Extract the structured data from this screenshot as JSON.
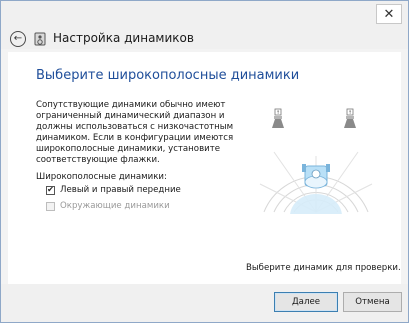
{
  "window": {
    "title": "Настройка динамиков",
    "close_glyph": "✕",
    "back_glyph": "←"
  },
  "page": {
    "heading": "Выберите широкополосные динамики",
    "description": "Сопутствующие динамики обычно имеют ограниченный динамический диапазон и должны использоваться с низкочастотным динамиком.  Если в конфигурации имеются широкополосные динамики, установите соответствующие флажки.",
    "checkbox_section_label": "Широкополосные динамики:",
    "checkboxes": [
      {
        "label": "Левый и правый передние",
        "checked": true,
        "enabled": true
      },
      {
        "label": "Окружающие динамики",
        "checked": false,
        "enabled": false
      }
    ],
    "test_hint": "Выберите динамик для проверки.",
    "check_glyph": "✔"
  },
  "footer": {
    "next_label": "Далее",
    "cancel_label": "Отмена"
  },
  "diagram": {
    "speaker_icons": [
      "front-left-speaker-icon",
      "front-right-speaker-icon",
      "listener-icon"
    ]
  }
}
